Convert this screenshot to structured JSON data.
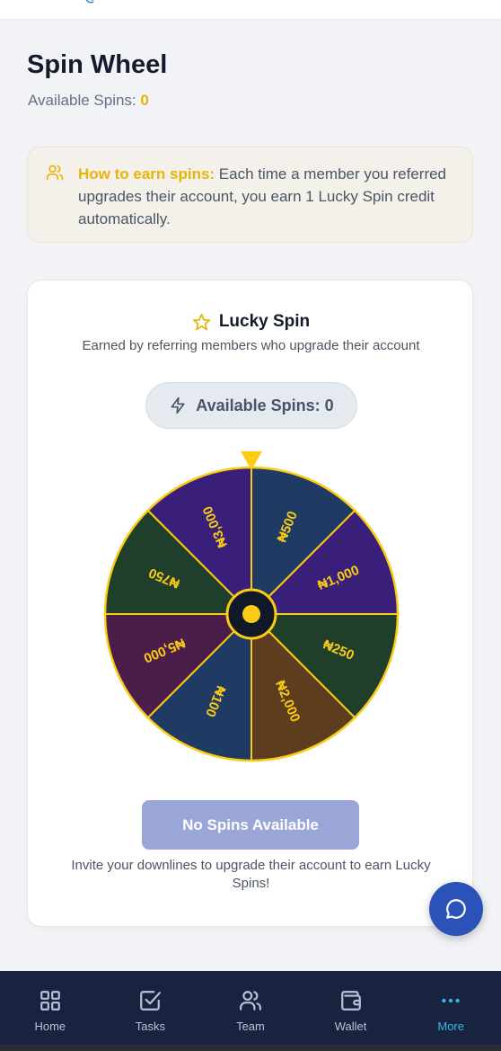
{
  "page": {
    "title": "Spin Wheel",
    "available_label": "Available Spins: ",
    "available_count": "0"
  },
  "info": {
    "lead": "How to earn spins:",
    "text": " Each time a member you referred upgrades their account, you earn 1 Lucky Spin credit automatically."
  },
  "card": {
    "title": "Lucky Spin",
    "subtitle": "Earned by referring members who upgrade their account",
    "spins_pill": "Available Spins: 0",
    "button_label": "No Spins Available",
    "note": "Invite your downlines to upgrade their account to earn Lucky Spins!"
  },
  "wheel": {
    "segments": [
      {
        "label": "₦500",
        "color": "#1f3a63"
      },
      {
        "label": "₦1,000",
        "color": "#3a1f7a"
      },
      {
        "label": "₦250",
        "color": "#1f3f2a"
      },
      {
        "label": "₦2,000",
        "color": "#5e3c1e"
      },
      {
        "label": "₦100",
        "color": "#1f3a63"
      },
      {
        "label": "₦5,000",
        "color": "#4a1d4a"
      },
      {
        "label": "₦750",
        "color": "#1f3f2a"
      },
      {
        "label": "₦3,000",
        "color": "#3a1f7a"
      }
    ],
    "accent": "#facc15"
  },
  "nav": {
    "items": [
      {
        "label": "Home",
        "icon": "grid-icon"
      },
      {
        "label": "Tasks",
        "icon": "check-square-icon"
      },
      {
        "label": "Team",
        "icon": "users-icon"
      },
      {
        "label": "Wallet",
        "icon": "wallet-icon"
      },
      {
        "label": "More",
        "icon": "more-dots-icon"
      }
    ]
  },
  "colors": {
    "accent": "#eab308",
    "nav_bg": "#18233f",
    "nav_active": "#38b6e8",
    "fab": "#2b52b8",
    "button_disabled": "#9aa6d8"
  }
}
